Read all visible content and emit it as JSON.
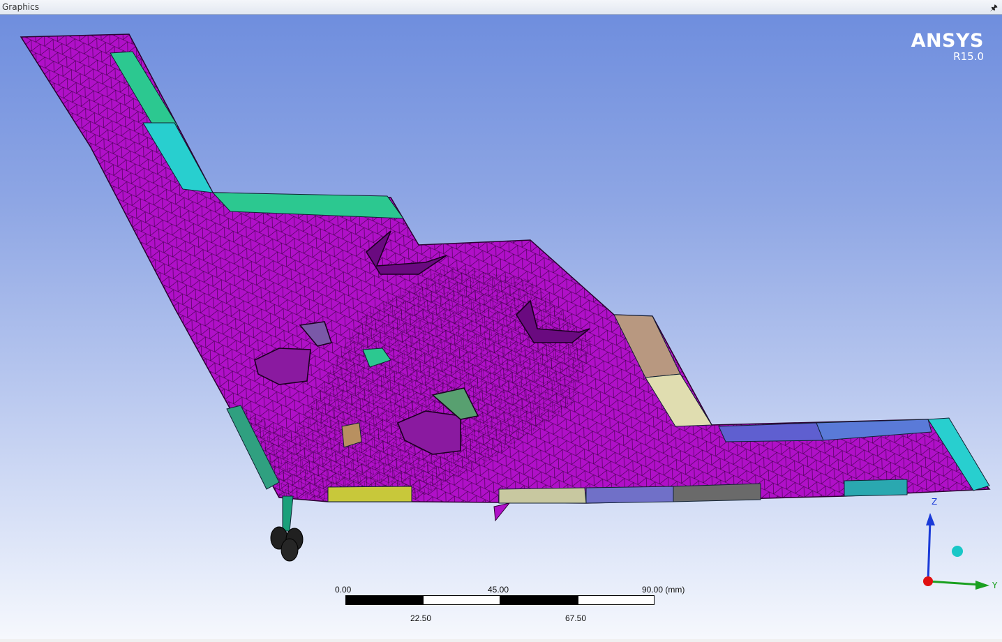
{
  "panel": {
    "title": "Graphics",
    "pin_icon": "pushpin-icon"
  },
  "brand": {
    "name": "ANSYS",
    "version": "R15.0"
  },
  "viewport": {
    "background_top": "#6f8ede",
    "background_bottom": "#f6f8fd"
  },
  "model": {
    "mesh_color": "#b010c8",
    "edge_color": "#2a0030"
  },
  "scale_bar": {
    "top_labels": [
      "0.00",
      "45.00",
      "90.00 (mm)"
    ],
    "bottom_labels": [
      "22.50",
      "67.50"
    ]
  },
  "triad": {
    "z_label": "Z",
    "y_label": "Y",
    "z_color": "#1a3ad8",
    "y_color": "#1aa020",
    "x_color": "#e01010",
    "iso_ball_color": "#19c7c7"
  }
}
